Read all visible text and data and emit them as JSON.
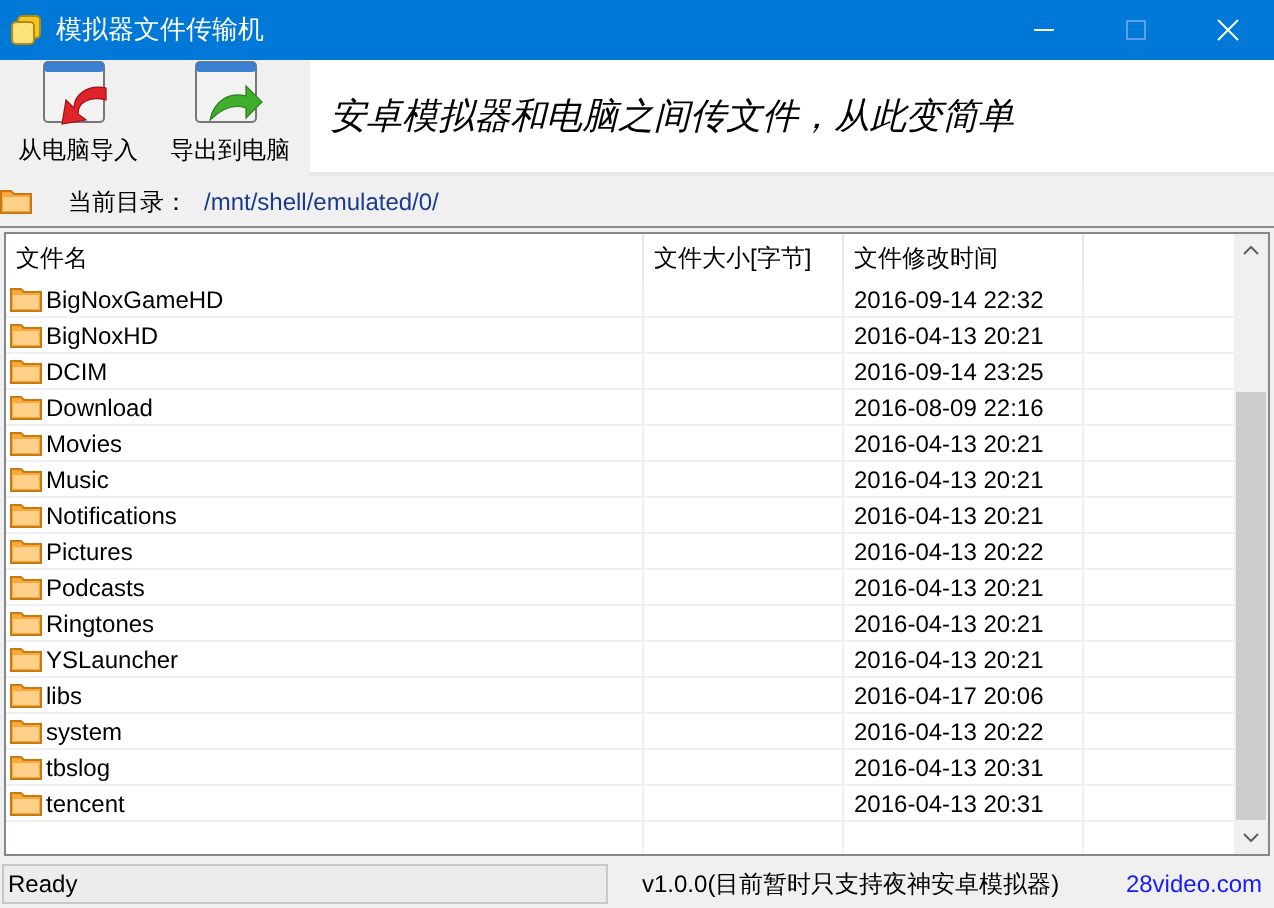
{
  "window": {
    "title": "模拟器文件传输机"
  },
  "toolbar": {
    "buttons": [
      {
        "label": "从电脑导入",
        "kind": "import"
      },
      {
        "label": "导出到电脑",
        "kind": "export"
      }
    ],
    "slogan": "安卓模拟器和电脑之间传文件，从此变简单"
  },
  "path_bar": {
    "label": "当前目录：",
    "path": "/mnt/shell/emulated/0/"
  },
  "table": {
    "columns": [
      "文件名",
      "文件大小[字节]",
      "文件修改时间"
    ],
    "rows": [
      {
        "name": "BigNoxGameHD",
        "modified": "2016-09-14 22:32"
      },
      {
        "name": "BigNoxHD",
        "modified": "2016-04-13 20:21"
      },
      {
        "name": "DCIM",
        "modified": "2016-09-14 23:25"
      },
      {
        "name": "Download",
        "modified": "2016-08-09 22:16"
      },
      {
        "name": "Movies",
        "modified": "2016-04-13 20:21"
      },
      {
        "name": "Music",
        "modified": "2016-04-13 20:21"
      },
      {
        "name": "Notifications",
        "modified": "2016-04-13 20:21"
      },
      {
        "name": "Pictures",
        "modified": "2016-04-13 20:22"
      },
      {
        "name": "Podcasts",
        "modified": "2016-04-13 20:21"
      },
      {
        "name": "Ringtones",
        "modified": "2016-04-13 20:21"
      },
      {
        "name": "YSLauncher",
        "modified": "2016-04-13 20:21"
      },
      {
        "name": "libs",
        "modified": "2016-04-17 20:06"
      },
      {
        "name": "system",
        "modified": "2016-04-13 20:22"
      },
      {
        "name": "tbslog",
        "modified": "2016-04-13 20:31"
      },
      {
        "name": "tencent",
        "modified": "2016-04-13 20:31"
      }
    ]
  },
  "status_bar": {
    "status": "Ready",
    "version": "v1.0.0(目前暂时只支持夜神安卓模拟器)",
    "link": "28video.com"
  }
}
